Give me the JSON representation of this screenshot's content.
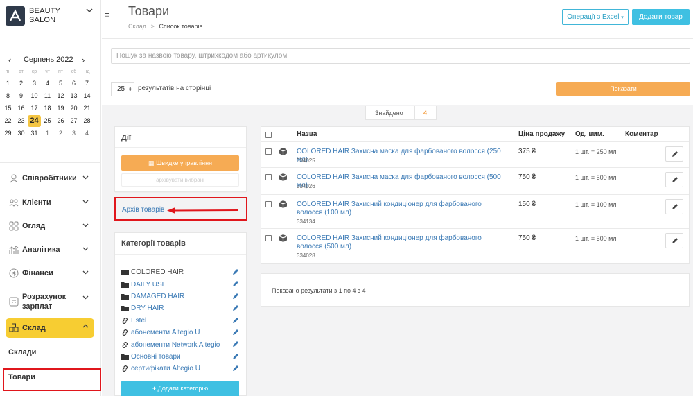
{
  "sidebar": {
    "brand": {
      "line1": "BEAUTY",
      "line2": "SALON"
    },
    "calendar": {
      "title": "Серпень 2022",
      "prev": "‹",
      "next": "›",
      "weekdays": [
        "пн",
        "вт",
        "ср",
        "чт",
        "пт",
        "сб",
        "нд"
      ],
      "weeks": [
        [
          "1",
          "2",
          "3",
          "4",
          "5",
          "6",
          "7"
        ],
        [
          "8",
          "9",
          "10",
          "11",
          "12",
          "13",
          "14"
        ],
        [
          "15",
          "16",
          "17",
          "18",
          "19",
          "20",
          "21"
        ],
        [
          "22",
          "23",
          "24",
          "25",
          "26",
          "27",
          "28"
        ],
        [
          "29",
          "30",
          "31",
          "1",
          "2",
          "3",
          "4"
        ]
      ],
      "selected": "24"
    },
    "nav": [
      {
        "label": "Співробітники",
        "icon": "person-icon"
      },
      {
        "label": "Клієнти",
        "icon": "clients-icon"
      },
      {
        "label": "Огляд",
        "icon": "grid-icon"
      },
      {
        "label": "Аналітика",
        "icon": "analytics-icon"
      },
      {
        "label": "Фінанси",
        "icon": "coin-icon"
      },
      {
        "label": "Розрахунок зарплат",
        "icon": "calculator-icon"
      },
      {
        "label": "Склад",
        "icon": "warehouse-icon",
        "active": true
      }
    ],
    "sub": [
      "Склади",
      "Товари"
    ]
  },
  "header": {
    "title": "Товари",
    "breadcrumb": {
      "parent": "Склад",
      "sep": ">",
      "current": "Список товарів"
    },
    "excel_label": "Операції з Excel",
    "add_label": "Додати товар"
  },
  "filters": {
    "search_placeholder": "Пошук за назвою товару, штрихкодом або артикулом",
    "per_page": "25",
    "per_page_label": "результатів на сторінці",
    "show_label": "Показати"
  },
  "found": {
    "label": "Знайдено",
    "count": "4"
  },
  "actions": {
    "title": "Дії",
    "quick_label": "Швидке управління",
    "archive_selected": "архівувати вибрані",
    "archive_link": "Архів товарів"
  },
  "categories": {
    "title": "Категорії товарів",
    "items": [
      {
        "label": "COLORED HAIR",
        "type": "folder"
      },
      {
        "label": "DAILY USE",
        "type": "folder-link"
      },
      {
        "label": "DAMAGED HAIR",
        "type": "folder-link"
      },
      {
        "label": "DRY HAIR",
        "type": "folder-link"
      },
      {
        "label": "Estel",
        "type": "link"
      },
      {
        "label": "абонементи Altegio U",
        "type": "link"
      },
      {
        "label": "абонементи Network Altegio",
        "type": "link"
      },
      {
        "label": "Основні товари",
        "type": "folder-link"
      },
      {
        "label": "сертифікати Altegio U",
        "type": "link"
      }
    ],
    "add_label": "Додати категорію"
  },
  "table": {
    "columns": [
      "Назва",
      "Ціна продажу",
      "Од. вим.",
      "Коментар"
    ],
    "rows": [
      {
        "name": "COLORED HAIR Захисна маска для фарбованого волосся (250 мл)",
        "code": "334025",
        "price": "375 ₴",
        "unit": "1 шт. = 250 мл"
      },
      {
        "name": "COLORED HAIR Захисна маска для фарбованого волосся (500 мл)",
        "code": "334026",
        "price": "750 ₴",
        "unit": "1 шт. = 500 мл"
      },
      {
        "name": "COLORED HAIR Захисний кондиціонер для фарбованого волосся (100 мл)",
        "code": "334134",
        "price": "150 ₴",
        "unit": "1 шт. = 100 мл"
      },
      {
        "name": "COLORED HAIR Захисний кондиціонер для фарбованого волосся (500 мл)",
        "code": "334028",
        "price": "750 ₴",
        "unit": "1 шт. = 500 мл"
      }
    ],
    "results_text": "Показано результати з 1 по 4 з 4"
  },
  "colors": {
    "accent_orange": "#f6ab54",
    "accent_cyan": "#3fc0e2",
    "active_yellow": "#f7cd32",
    "highlight_red": "#e0161c"
  }
}
